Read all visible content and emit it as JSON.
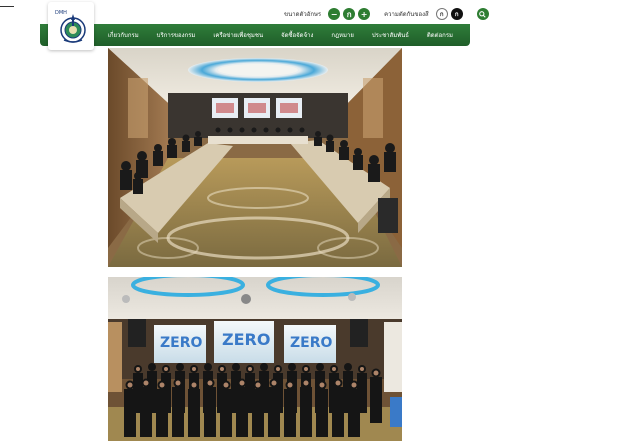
{
  "logo": {
    "text": "DMH"
  },
  "utility": {
    "font_size_label": "ขนาดตัวอักษร",
    "decrease_font": "−",
    "normal_font": "ก",
    "increase_font": "+",
    "contrast_label": "ความตัดกันของสี",
    "contrast_normal": "ก",
    "contrast_high": "ก"
  },
  "nav": {
    "items": [
      "เกี่ยวกับกรม",
      "บริการของกรม",
      "เครือข่ายเพื่อชุมชน",
      "จัดซื้อจัดจ้าง",
      "กฎหมาย",
      "ประชาสัมพันธ์",
      "ติดต่อกรม"
    ]
  },
  "colors": {
    "nav_green": "#2f7d3a",
    "accent_green": "#2e7d32"
  },
  "icons": {
    "search": "search-icon",
    "logo": "department-logo-icon"
  },
  "photos": [
    {
      "name": "meeting-room-photo"
    },
    {
      "name": "group-photo"
    }
  ]
}
